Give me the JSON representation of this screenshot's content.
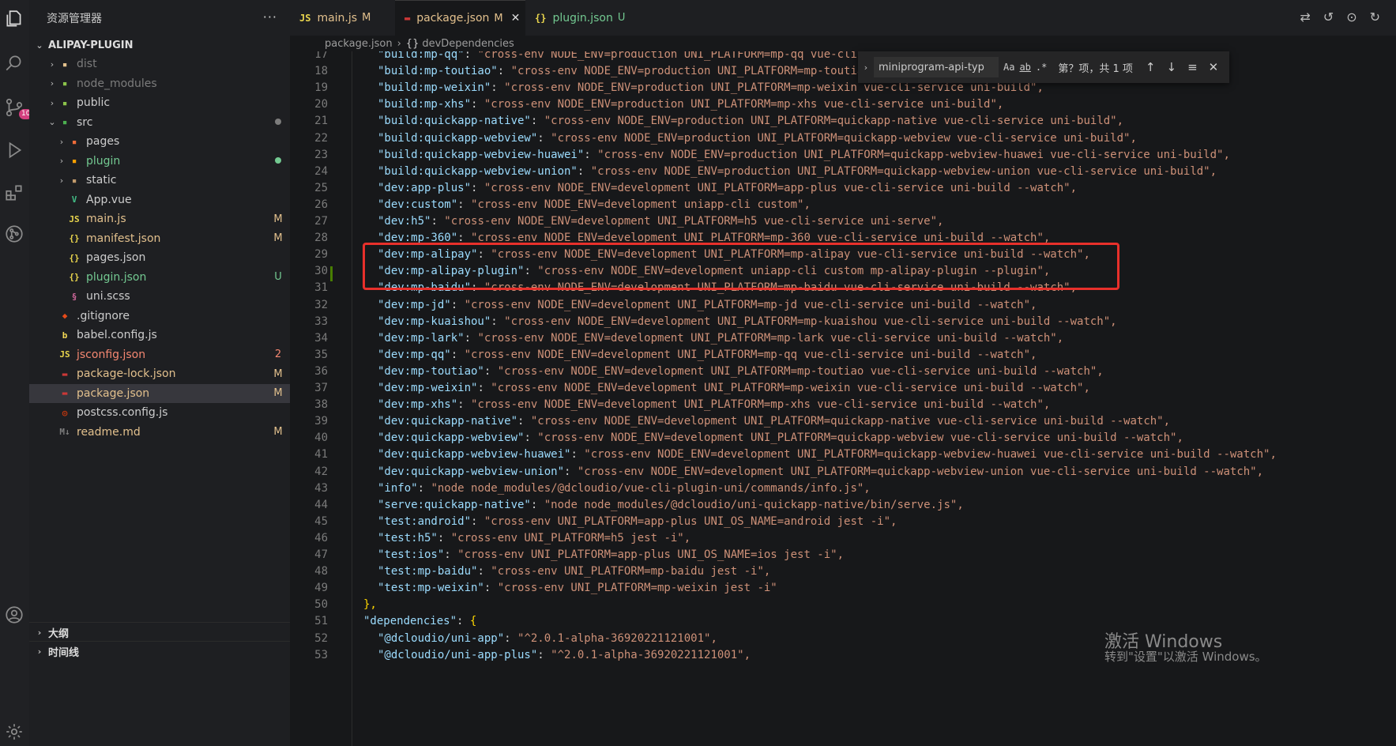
{
  "colors": {
    "modified": "#e2c08d",
    "untracked": "#73c991",
    "error": "#f48771",
    "ignored": "#7c7c7c",
    "badge": "#d23f7f",
    "highlight_box": "#e8302b"
  },
  "activity_bar": {
    "items": [
      {
        "name": "explorer-icon"
      },
      {
        "name": "search-icon"
      },
      {
        "name": "source-control-icon",
        "badge": "10"
      },
      {
        "name": "run-debug-icon"
      },
      {
        "name": "extensions-icon"
      },
      {
        "name": "git-graph-icon"
      },
      {
        "name": "account-icon"
      },
      {
        "name": "settings-gear-icon"
      }
    ]
  },
  "sidebar": {
    "title": "资源管理器",
    "more": "···",
    "root": "ALIPAY-PLUGIN",
    "items": [
      {
        "label": "dist",
        "chev": "›",
        "icon": "folder-dist-icon",
        "glyph": "▪",
        "glyph_color": "#e2c08d",
        "label_color": "#7c7c7c",
        "status": ""
      },
      {
        "label": "node_modules",
        "chev": "›",
        "icon": "folder-node-icon",
        "glyph": "▪",
        "glyph_color": "#8bc34a",
        "label_color": "#7c7c7c",
        "status": ""
      },
      {
        "label": "public",
        "chev": "›",
        "icon": "folder-public-icon",
        "glyph": "▪",
        "glyph_color": "#8bc34a",
        "label_color": "#cccccc",
        "status": ""
      },
      {
        "label": "src",
        "chev": "⌄",
        "icon": "folder-src-icon",
        "glyph": "▪",
        "glyph_color": "#4caf50",
        "label_color": "#cccccc",
        "status": "dot",
        "status_color": "#7c7c7c",
        "indent": 0
      },
      {
        "label": "pages",
        "chev": "›",
        "icon": "folder-pages-icon",
        "glyph": "▪",
        "glyph_color": "#ef6c3a",
        "label_color": "#cccccc",
        "status": "",
        "indent": 1
      },
      {
        "label": "plugin",
        "chev": "›",
        "icon": "folder-plugin-icon",
        "glyph": "▪",
        "glyph_color": "#ffa000",
        "label_color": "#73c991",
        "status": "dot",
        "status_color": "#73c991",
        "indent": 1
      },
      {
        "label": "static",
        "chev": "›",
        "icon": "folder-static-icon",
        "glyph": "▪",
        "glyph_color": "#c19a6b",
        "label_color": "#cccccc",
        "status": "",
        "indent": 1
      },
      {
        "label": "App.vue",
        "chev": "",
        "icon": "vue-file-icon",
        "glyph": "V",
        "glyph_color": "#41b883",
        "label_color": "#cccccc",
        "status": "",
        "indent": 1
      },
      {
        "label": "main.js",
        "chev": "",
        "icon": "js-file-icon",
        "glyph": "JS",
        "glyph_color": "#e8d44d",
        "label_color": "#e2c08d",
        "status": "M",
        "status_color": "#e2c08d",
        "indent": 1
      },
      {
        "label": "manifest.json",
        "chev": "",
        "icon": "json-file-icon",
        "glyph": "{}",
        "glyph_color": "#e8d44d",
        "label_color": "#e2c08d",
        "status": "M",
        "status_color": "#e2c08d",
        "indent": 1
      },
      {
        "label": "pages.json",
        "chev": "",
        "icon": "json-file-icon",
        "glyph": "{}",
        "glyph_color": "#e8d44d",
        "label_color": "#cccccc",
        "status": "",
        "indent": 1
      },
      {
        "label": "plugin.json",
        "chev": "",
        "icon": "json-file-icon",
        "glyph": "{}",
        "glyph_color": "#e8d44d",
        "label_color": "#73c991",
        "status": "U",
        "status_color": "#73c991",
        "indent": 1
      },
      {
        "label": "uni.scss",
        "chev": "",
        "icon": "scss-file-icon",
        "glyph": "§",
        "glyph_color": "#cd6799",
        "label_color": "#cccccc",
        "status": "",
        "indent": 1
      },
      {
        "label": ".gitignore",
        "chev": "",
        "icon": "git-file-icon",
        "glyph": "◆",
        "glyph_color": "#e64a19",
        "label_color": "#cccccc",
        "status": ""
      },
      {
        "label": "babel.config.js",
        "chev": "",
        "icon": "babel-file-icon",
        "glyph": "b",
        "glyph_color": "#f5da55",
        "label_color": "#cccccc",
        "status": ""
      },
      {
        "label": "jsconfig.json",
        "chev": "",
        "icon": "js-file-icon",
        "glyph": "JS",
        "glyph_color": "#e8d44d",
        "label_color": "#f48771",
        "status": "2",
        "status_color": "#f48771"
      },
      {
        "label": "package-lock.json",
        "chev": "",
        "icon": "npm-file-icon",
        "glyph": "▬",
        "glyph_color": "#cb3837",
        "label_color": "#e2c08d",
        "status": "M",
        "status_color": "#e2c08d"
      },
      {
        "label": "package.json",
        "chev": "",
        "icon": "npm-file-icon",
        "glyph": "▬",
        "glyph_color": "#cb3837",
        "label_color": "#e2c08d",
        "status": "M",
        "status_color": "#e2c08d",
        "active": true
      },
      {
        "label": "postcss.config.js",
        "chev": "",
        "icon": "postcss-file-icon",
        "glyph": "◎",
        "glyph_color": "#dd3a0a",
        "label_color": "#cccccc",
        "status": ""
      },
      {
        "label": "readme.md",
        "chev": "",
        "icon": "markdown-file-icon",
        "glyph": "M↓",
        "glyph_color": "#7c7c7c",
        "label_color": "#e2c08d",
        "status": "M",
        "status_color": "#e2c08d"
      }
    ],
    "outline": "大纲",
    "timeline": "时间线"
  },
  "tabs": [
    {
      "label": "main.js",
      "icon": "JS",
      "icon_color": "#e8d44d",
      "status": "M",
      "color": "#e2c08d",
      "active": false
    },
    {
      "label": "package.json",
      "icon": "▬",
      "icon_color": "#cb3837",
      "status": "M",
      "color": "#e2c08d",
      "active": true,
      "close": "✕"
    },
    {
      "label": "plugin.json",
      "icon": "{}",
      "icon_color": "#e8d44d",
      "status": "U",
      "color": "#73c991",
      "active": false
    }
  ],
  "breadcrumb": {
    "file": "package.json",
    "symbol_icon": "{}",
    "symbol": "devDependencies"
  },
  "find": {
    "query": "miniprogram-api-typ",
    "case": "Aa",
    "word": "ab",
    "regex": ".*",
    "count": "第？项，共 1 项",
    "prev": "↑",
    "next": "↓",
    "selection": "≡",
    "close": "✕"
  },
  "editor": {
    "lines": [
      {
        "n": "17",
        "key": "\"build:mp-qq\"",
        "val": "\"cross-env NODE_ENV=production UNI_PLATFORM=mp-qq vue-cli-service uni-build\","
      },
      {
        "n": "18",
        "key": "\"build:mp-toutiao\"",
        "val": "\"cross-env NODE_ENV=production UNI_PLATFORM=mp-toutiao vue-cli-service uni-build\","
      },
      {
        "n": "19",
        "key": "\"build:mp-weixin\"",
        "val": "\"cross-env NODE_ENV=production UNI_PLATFORM=mp-weixin vue-cli-service uni-build\","
      },
      {
        "n": "20",
        "key": "\"build:mp-xhs\"",
        "val": "\"cross-env NODE_ENV=production UNI_PLATFORM=mp-xhs vue-cli-service uni-build\","
      },
      {
        "n": "21",
        "key": "\"build:quickapp-native\"",
        "val": "\"cross-env NODE_ENV=production UNI_PLATFORM=quickapp-native vue-cli-service uni-build\","
      },
      {
        "n": "22",
        "key": "\"build:quickapp-webview\"",
        "val": "\"cross-env NODE_ENV=production UNI_PLATFORM=quickapp-webview vue-cli-service uni-build\","
      },
      {
        "n": "23",
        "key": "\"build:quickapp-webview-huawei\"",
        "val": "\"cross-env NODE_ENV=production UNI_PLATFORM=quickapp-webview-huawei vue-cli-service uni-build\","
      },
      {
        "n": "24",
        "key": "\"build:quickapp-webview-union\"",
        "val": "\"cross-env NODE_ENV=production UNI_PLATFORM=quickapp-webview-union vue-cli-service uni-build\","
      },
      {
        "n": "25",
        "key": "\"dev:app-plus\"",
        "val": "\"cross-env NODE_ENV=development UNI_PLATFORM=app-plus vue-cli-service uni-build --watch\","
      },
      {
        "n": "26",
        "key": "\"dev:custom\"",
        "val": "\"cross-env NODE_ENV=development uniapp-cli custom\","
      },
      {
        "n": "27",
        "key": "\"dev:h5\"",
        "val": "\"cross-env NODE_ENV=development UNI_PLATFORM=h5 vue-cli-service uni-serve\","
      },
      {
        "n": "28",
        "key": "\"dev:mp-360\"",
        "val": "\"cross-env NODE_ENV=development UNI_PLATFORM=mp-360 vue-cli-service uni-build --watch\","
      },
      {
        "n": "29",
        "key": "\"dev:mp-alipay\"",
        "val": "\"cross-env NODE_ENV=development UNI_PLATFORM=mp-alipay vue-cli-service uni-build --watch\","
      },
      {
        "n": "30",
        "key": "\"dev:mp-alipay-plugin\"",
        "val": "\"cross-env NODE_ENV=development uniapp-cli custom mp-alipay-plugin --plugin\",",
        "git": true
      },
      {
        "n": "31",
        "key": "\"dev:mp-baidu\"",
        "val": "\"cross-env NODE_ENV=development UNI_PLATFORM=mp-baidu vue-cli-service uni-build --watch\","
      },
      {
        "n": "32",
        "key": "\"dev:mp-jd\"",
        "val": "\"cross-env NODE_ENV=development UNI_PLATFORM=mp-jd vue-cli-service uni-build --watch\","
      },
      {
        "n": "33",
        "key": "\"dev:mp-kuaishou\"",
        "val": "\"cross-env NODE_ENV=development UNI_PLATFORM=mp-kuaishou vue-cli-service uni-build --watch\","
      },
      {
        "n": "34",
        "key": "\"dev:mp-lark\"",
        "val": "\"cross-env NODE_ENV=development UNI_PLATFORM=mp-lark vue-cli-service uni-build --watch\","
      },
      {
        "n": "35",
        "key": "\"dev:mp-qq\"",
        "val": "\"cross-env NODE_ENV=development UNI_PLATFORM=mp-qq vue-cli-service uni-build --watch\","
      },
      {
        "n": "36",
        "key": "\"dev:mp-toutiao\"",
        "val": "\"cross-env NODE_ENV=development UNI_PLATFORM=mp-toutiao vue-cli-service uni-build --watch\","
      },
      {
        "n": "37",
        "key": "\"dev:mp-weixin\"",
        "val": "\"cross-env NODE_ENV=development UNI_PLATFORM=mp-weixin vue-cli-service uni-build --watch\","
      },
      {
        "n": "38",
        "key": "\"dev:mp-xhs\"",
        "val": "\"cross-env NODE_ENV=development UNI_PLATFORM=mp-xhs vue-cli-service uni-build --watch\","
      },
      {
        "n": "39",
        "key": "\"dev:quickapp-native\"",
        "val": "\"cross-env NODE_ENV=development UNI_PLATFORM=quickapp-native vue-cli-service uni-build --watch\","
      },
      {
        "n": "40",
        "key": "\"dev:quickapp-webview\"",
        "val": "\"cross-env NODE_ENV=development UNI_PLATFORM=quickapp-webview vue-cli-service uni-build --watch\","
      },
      {
        "n": "41",
        "key": "\"dev:quickapp-webview-huawei\"",
        "val": "\"cross-env NODE_ENV=development UNI_PLATFORM=quickapp-webview-huawei vue-cli-service uni-build --watch\","
      },
      {
        "n": "42",
        "key": "\"dev:quickapp-webview-union\"",
        "val": "\"cross-env NODE_ENV=development UNI_PLATFORM=quickapp-webview-union vue-cli-service uni-build --watch\","
      },
      {
        "n": "43",
        "key": "\"info\"",
        "val": "\"node node_modules/@dcloudio/vue-cli-plugin-uni/commands/info.js\","
      },
      {
        "n": "44",
        "key": "\"serve:quickapp-native\"",
        "val": "\"node node_modules/@dcloudio/uni-quickapp-native/bin/serve.js\","
      },
      {
        "n": "45",
        "key": "\"test:android\"",
        "val": "\"cross-env UNI_PLATFORM=app-plus UNI_OS_NAME=android jest -i\","
      },
      {
        "n": "46",
        "key": "\"test:h5\"",
        "val": "\"cross-env UNI_PLATFORM=h5 jest -i\","
      },
      {
        "n": "47",
        "key": "\"test:ios\"",
        "val": "\"cross-env UNI_PLATFORM=app-plus UNI_OS_NAME=ios jest -i\","
      },
      {
        "n": "48",
        "key": "\"test:mp-baidu\"",
        "val": "\"cross-env UNI_PLATFORM=mp-baidu jest -i\","
      },
      {
        "n": "49",
        "key": "\"test:mp-weixin\"",
        "val": "\"cross-env UNI_PLATFORM=mp-weixin jest -i\""
      },
      {
        "n": "50",
        "raw": "},",
        "indent": 1
      },
      {
        "n": "51",
        "key": "\"dependencies\"",
        "val": "{",
        "indent": 1,
        "brace": true
      },
      {
        "n": "52",
        "key": "\"@dcloudio/uni-app\"",
        "val": "\"^2.0.1-alpha-36920221121001\","
      },
      {
        "n": "53",
        "key": "\"@dcloudio/uni-app-plus\"",
        "val": "\"^2.0.1-alpha-36920221121001\","
      }
    ]
  },
  "watermark": {
    "line1": "激活 Windows",
    "line2": "转到\"设置\"以激活 Windows。"
  }
}
